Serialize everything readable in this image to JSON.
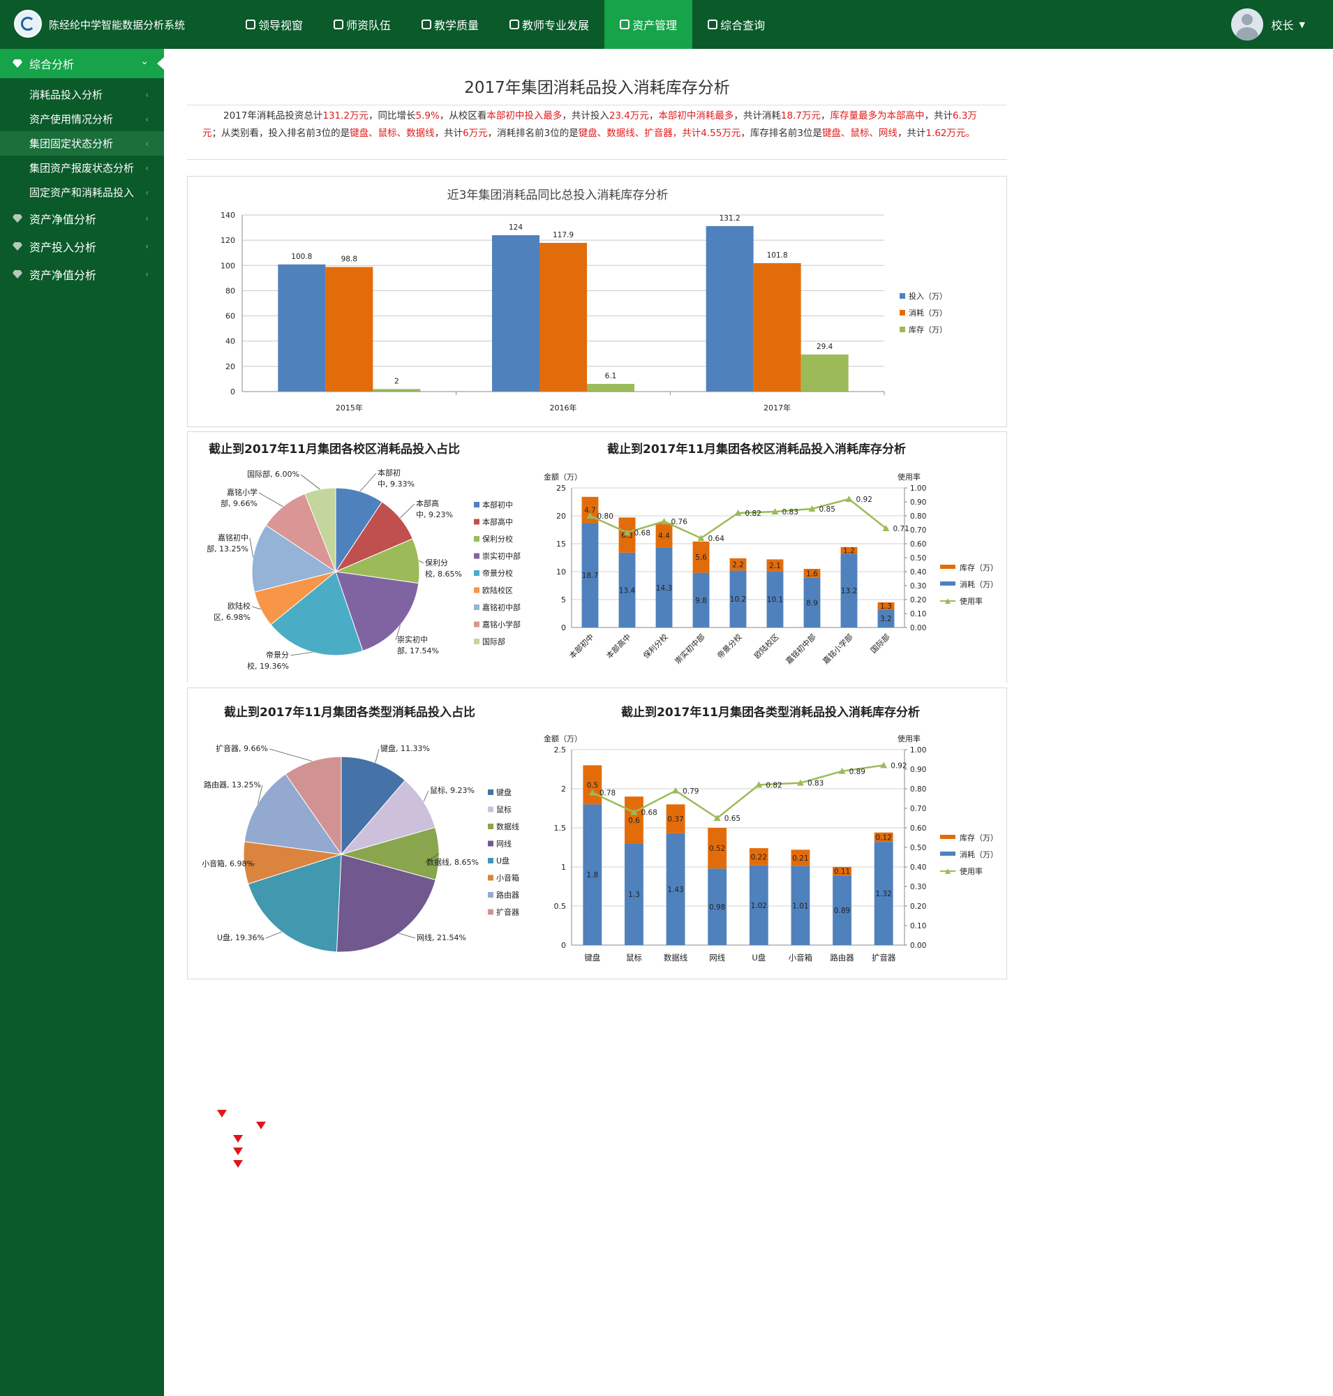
{
  "app": {
    "title": "陈经纶中学智能数据分析系统"
  },
  "nav": {
    "items": [
      {
        "label": "领导视窗",
        "icon": "leader-icon"
      },
      {
        "label": "师资队伍",
        "icon": "teacher-icon"
      },
      {
        "label": "教学质量",
        "icon": "quality-icon"
      },
      {
        "label": "教师专业发展",
        "icon": "pie-icon"
      },
      {
        "label": "资产管理",
        "icon": "asset-icon",
        "active": true
      },
      {
        "label": "综合查询",
        "icon": "query-icon"
      }
    ]
  },
  "user": {
    "name": "校长"
  },
  "sidebar": {
    "main": "综合分析",
    "sub": [
      "消耗品投入分析",
      "资产使用情况分析",
      "集团固定状态分析",
      "集团资产报废状态分析",
      "固定资产和消耗品投入"
    ],
    "groups": [
      "资产净值分析",
      "资产投入分析",
      "资产净值分析"
    ]
  },
  "page": {
    "title": "2017年集团消耗品投入消耗库存分析",
    "summary": [
      {
        "t": "2017年消耗品投资总计",
        "r": false
      },
      {
        "t": "131.2万元",
        "r": true
      },
      {
        "t": "，同比增长",
        "r": false
      },
      {
        "t": "5.9%",
        "r": true
      },
      {
        "t": "，从校区看",
        "r": false
      },
      {
        "t": "本部初中投入最多",
        "r": true
      },
      {
        "t": "，共计投入",
        "r": false
      },
      {
        "t": "23.4万元",
        "r": true
      },
      {
        "t": "，",
        "r": false
      },
      {
        "t": "本部初中消耗最多",
        "r": true
      },
      {
        "t": "，共计消耗",
        "r": false
      },
      {
        "t": "18.7万元",
        "r": true
      },
      {
        "t": "，",
        "r": false
      },
      {
        "t": "库存量最多为本部高中",
        "r": true
      },
      {
        "t": "，共计",
        "r": false
      },
      {
        "t": "6.3万元",
        "r": true
      },
      {
        "t": "；从类别看，投入排名前3位的是",
        "r": false
      },
      {
        "t": "键盘、鼠标、数据线",
        "r": true
      },
      {
        "t": "，共计",
        "r": false
      },
      {
        "t": "6万元",
        "r": true
      },
      {
        "t": "，消耗排名前3位的是",
        "r": false
      },
      {
        "t": "键盘、数据线、扩音器",
        "r": true
      },
      {
        "t": "，共计4.55万元",
        "r": true
      },
      {
        "t": "，库存排名前3位是",
        "r": false
      },
      {
        "t": "键盘、鼠标、网线",
        "r": true
      },
      {
        "t": "，共计",
        "r": false
      },
      {
        "t": "1.62万元。",
        "r": true
      }
    ]
  },
  "colors": {
    "blue": "#4f81bd",
    "orange": "#e36c0a",
    "green": "#9bbb59",
    "red": "#c0504d",
    "purple": "#8064a2",
    "teal": "#4bacc6",
    "lightorange": "#f79646",
    "lightblue": "#95b3d7",
    "pink": "#d99694",
    "lightgreen": "#c3d69b",
    "lavender": "#ccc0da"
  },
  "chart_data": [
    {
      "id": "yearly",
      "type": "bar",
      "title": "近3年集团消耗品同比总投入消耗库存分析",
      "categories": [
        "2015年",
        "2016年",
        "2017年"
      ],
      "series": [
        {
          "name": "投入（万）",
          "values": [
            100.8,
            124,
            131.2
          ],
          "color": "#4f81bd"
        },
        {
          "name": "消耗（万）",
          "values": [
            98.8,
            117.9,
            101.8
          ],
          "color": "#e36c0a"
        },
        {
          "name": "库存（万）",
          "values": [
            2,
            6.1,
            29.4
          ],
          "color": "#9bbb59"
        }
      ],
      "ylim": [
        0,
        140
      ],
      "yticks": [
        0,
        20,
        40,
        60,
        80,
        100,
        120,
        140
      ],
      "legend": "right"
    },
    {
      "id": "campus-pie",
      "type": "pie",
      "title": "截止到2017年11月集团各校区消耗品投入占比",
      "slices": [
        {
          "name": "本部初中",
          "value": 9.33,
          "label": [
            "本部初",
            "中, 9.33%"
          ],
          "color": "#4f81bd"
        },
        {
          "name": "本部高中",
          "value": 9.23,
          "label": [
            "本部高",
            "中, 9.23%"
          ],
          "color": "#c0504d"
        },
        {
          "name": "保利分校",
          "value": 8.65,
          "label": [
            "保利分",
            "校, 8.65%"
          ],
          "color": "#9bbb59"
        },
        {
          "name": "崇实初中部",
          "value": 17.54,
          "label": [
            "崇实初中",
            "部, 17.54%"
          ],
          "color": "#8064a2"
        },
        {
          "name": "帝景分校",
          "value": 19.36,
          "label": [
            "帝景分",
            "校, 19.36%"
          ],
          "color": "#4bacc6"
        },
        {
          "name": "欧陆校区",
          "value": 6.98,
          "label": [
            "欧陆校",
            "区, 6.98%"
          ],
          "color": "#f79646"
        },
        {
          "name": "嘉铭初中部",
          "value": 13.25,
          "label": [
            "嘉铭初中",
            "部, 13.25%"
          ],
          "color": "#95b3d7"
        },
        {
          "name": "嘉铭小学部",
          "value": 9.66,
          "label": [
            "嘉铭小学",
            "部, 9.66%"
          ],
          "color": "#d99694"
        },
        {
          "name": "国际部",
          "value": 6.0,
          "label": [
            "国际部, 6.00%"
          ],
          "color": "#c3d69b"
        }
      ],
      "legend": "right"
    },
    {
      "id": "campus-stack",
      "type": "bar",
      "title": "截止到2017年11月集团各校区消耗品投入消耗库存分析",
      "ylabel": "金额（万）",
      "y2label": "使用率",
      "categories": [
        "本部初中",
        "本部高中",
        "保利分校",
        "崇实初中部",
        "帝景分校",
        "欧陆校区",
        "嘉铭初中部",
        "嘉铭小学部",
        "国际部"
      ],
      "series": [
        {
          "name": "库存（万）",
          "values": [
            4.7,
            6.3,
            4.4,
            5.6,
            2.2,
            2.1,
            1.6,
            1.2,
            1.3
          ],
          "color": "#e36c0a"
        },
        {
          "name": "消耗（万）",
          "values": [
            18.7,
            13.4,
            14.3,
            9.8,
            10.2,
            10.1,
            8.9,
            13.2,
            3.2
          ],
          "color": "#4f81bd"
        },
        {
          "name": "使用率",
          "values": [
            0.8,
            0.68,
            0.76,
            0.64,
            0.82,
            0.83,
            0.85,
            0.92,
            0.71
          ],
          "color": "#9bbb59"
        }
      ],
      "ylim": [
        0,
        25
      ],
      "yticks": [
        0,
        5,
        10,
        15,
        20,
        25
      ],
      "y2lim": [
        0,
        1
      ],
      "y2ticks": [
        "0.00",
        "0.10",
        "0.20",
        "0.30",
        "0.40",
        "0.50",
        "0.60",
        "0.70",
        "0.80",
        "0.90",
        "1.00"
      ],
      "legend": "right"
    },
    {
      "id": "type-pie",
      "type": "pie",
      "title": "截止到2017年11月集团各类型消耗品投入占比",
      "slices": [
        {
          "name": "键盘",
          "value": 11.33,
          "label": [
            "键盘, 11.33%"
          ],
          "color": "#4572a7"
        },
        {
          "name": "鼠标",
          "value": 9.23,
          "label": [
            "鼠标, 9.23%"
          ],
          "color": "#ccc0da"
        },
        {
          "name": "数据线",
          "value": 8.65,
          "label": [
            "数据线, 8.65%"
          ],
          "color": "#89a54e"
        },
        {
          "name": "网线",
          "value": 21.54,
          "label": [
            "网线, 21.54%"
          ],
          "color": "#71588f"
        },
        {
          "name": "U盘",
          "value": 19.36,
          "label": [
            "U盘, 19.36%"
          ],
          "color": "#4198af"
        },
        {
          "name": "小音箱",
          "value": 6.98,
          "label": [
            "小音箱, 6.98%"
          ],
          "color": "#db843d"
        },
        {
          "name": "路由器",
          "value": 13.25,
          "label": [
            "路由器, 13.25%"
          ],
          "color": "#93a9cf"
        },
        {
          "name": "扩音器",
          "value": 9.66,
          "label": [
            "扩音器, 9.66%"
          ],
          "color": "#d19392"
        }
      ],
      "legend": "right"
    },
    {
      "id": "type-stack",
      "type": "bar",
      "title": "截止到2017年11月集团各类型消耗品投入消耗库存分析",
      "ylabel": "金额（万）",
      "y2label": "使用率",
      "categories": [
        "键盘",
        "鼠标",
        "数据线",
        "网线",
        "U盘",
        "小音箱",
        "路由器",
        "扩音器"
      ],
      "series": [
        {
          "name": "库存（万）",
          "values": [
            0.5,
            0.6,
            0.37,
            0.52,
            0.22,
            0.21,
            0.11,
            0.12
          ],
          "color": "#e36c0a"
        },
        {
          "name": "消耗（万）",
          "values": [
            1.8,
            1.3,
            1.43,
            0.98,
            1.02,
            1.01,
            0.89,
            1.32
          ],
          "color": "#4f81bd"
        },
        {
          "name": "使用率",
          "values": [
            0.78,
            0.68,
            0.79,
            0.65,
            0.82,
            0.83,
            0.89,
            0.92
          ],
          "color": "#9bbb59"
        }
      ],
      "ylim": [
        0,
        2.5
      ],
      "yticks": [
        0,
        0.5,
        1,
        1.5,
        2,
        2.5
      ],
      "y2lim": [
        0,
        1
      ],
      "y2ticks": [
        "0.00",
        "0.10",
        "0.20",
        "0.30",
        "0.40",
        "0.50",
        "0.60",
        "0.70",
        "0.80",
        "0.90",
        "1.00"
      ],
      "legend": "right"
    }
  ]
}
